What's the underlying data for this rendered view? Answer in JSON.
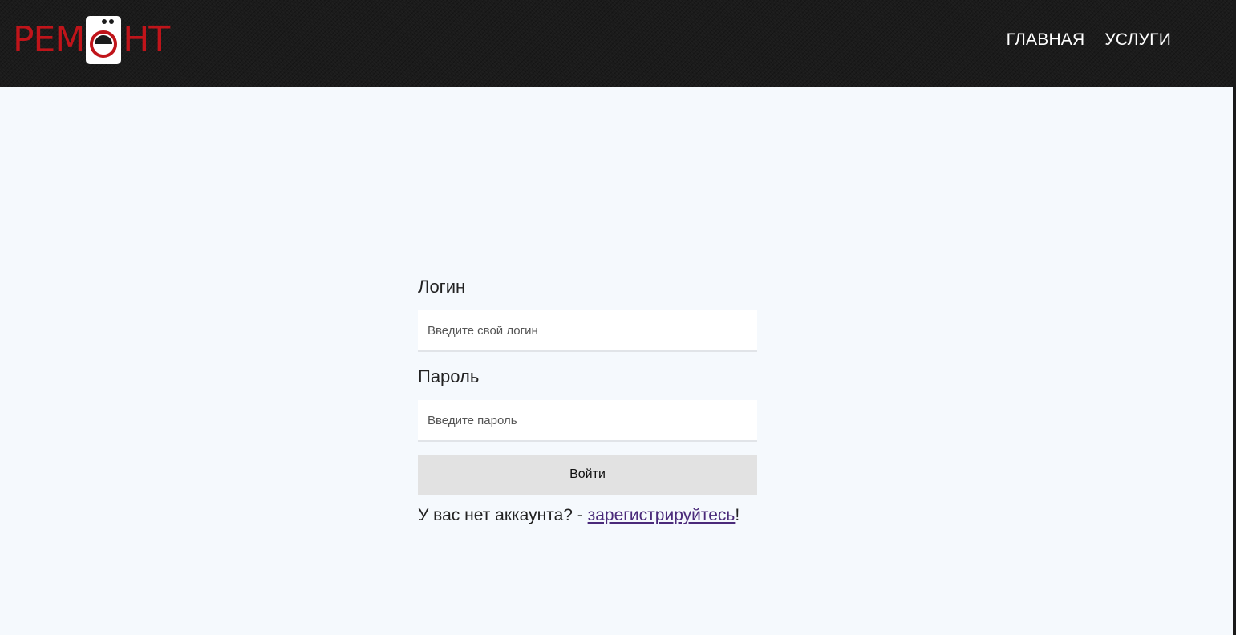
{
  "header": {
    "logo": {
      "left_text": "РЕМ",
      "right_text": "НТ",
      "icon": "washing-machine-icon",
      "color": "#c0141a"
    },
    "nav": [
      {
        "label": "ГЛАВНАЯ"
      },
      {
        "label": "УСЛУГИ"
      }
    ]
  },
  "form": {
    "login_label": "Логин",
    "login_placeholder": "Введите свой логин",
    "password_label": "Пароль",
    "password_placeholder": "Введите пароль",
    "submit_label": "Войти",
    "register_prompt": "У вас нет аккаунта? - ",
    "register_link": "зарегистрируйтесь",
    "register_suffix": "!"
  },
  "colors": {
    "header_bg": "#1b1b1b",
    "page_bg": "#f5f9fd",
    "button_bg": "#e2e2e2",
    "link": "#4a2a7a"
  }
}
